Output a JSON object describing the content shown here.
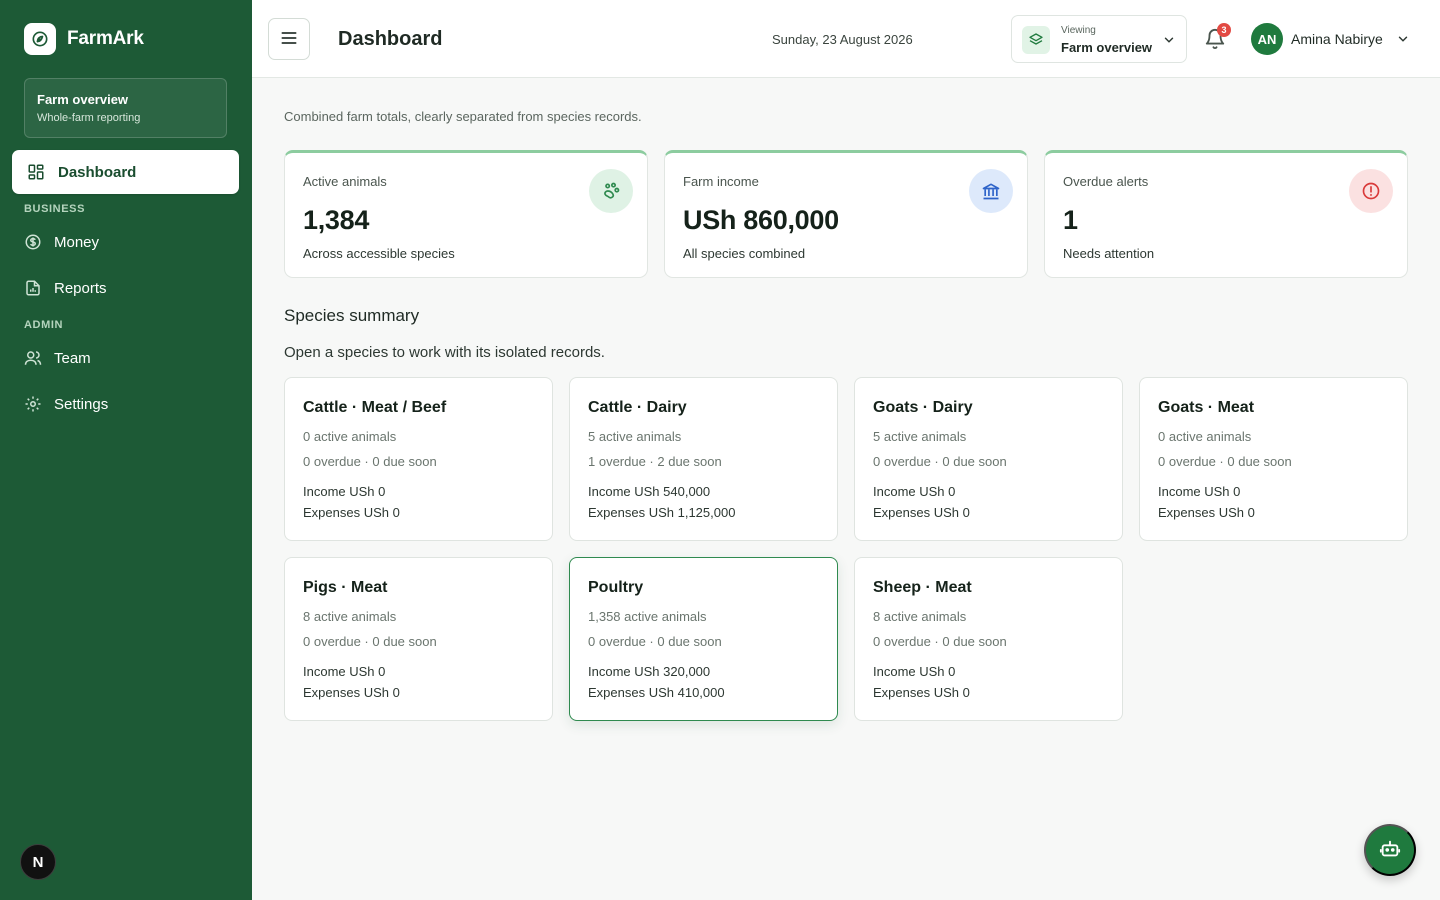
{
  "app": {
    "name": "FarmArk"
  },
  "sidebar": {
    "scope": {
      "title": "Farm overview",
      "subtitle": "Whole-farm reporting"
    },
    "active_item": {
      "label": "Dashboard",
      "icon": "dashboard-icon"
    },
    "sections": [
      {
        "label": "BUSINESS",
        "items": [
          {
            "label": "Money",
            "icon": "money-icon"
          },
          {
            "label": "Reports",
            "icon": "report-icon"
          }
        ]
      },
      {
        "label": "ADMIN",
        "items": [
          {
            "label": "Team",
            "icon": "user-icon"
          },
          {
            "label": "Settings",
            "icon": "gear-icon"
          }
        ]
      }
    ],
    "footer_badge": "N"
  },
  "header": {
    "title": "Dashboard",
    "date": "Sunday, 23 August 2026",
    "viewing_label": "Viewing",
    "viewing_value": "Farm overview",
    "notifications_count": "3",
    "user_initials": "AN",
    "user_name": "Amina Nabirye"
  },
  "main": {
    "intro": "Combined farm totals, clearly separated from species records.",
    "stats": [
      {
        "label": "Active animals",
        "value": "1,384",
        "sub": "Across accessible species",
        "icon": "paw-icon",
        "icon_bg": "#dff2e5",
        "icon_color": "#2f8a4f"
      },
      {
        "label": "Farm income",
        "value": "USh 860,000",
        "sub": "All species combined",
        "icon": "bank-icon",
        "icon_bg": "#dde9fb",
        "icon_color": "#2f64c9"
      },
      {
        "label": "Overdue alerts",
        "value": "1",
        "sub": "Needs attention",
        "icon": "alert-icon",
        "icon_bg": "#fbe1e1",
        "icon_color": "#d93a3a"
      }
    ],
    "species_title": "Species summary",
    "species_subtitle": "Open a species to work with its isolated records.",
    "species": [
      {
        "name": "Cattle · Meat / Beef",
        "animals": "0 active animals",
        "due": "0 overdue · 0 due soon",
        "income": "Income USh 0",
        "expenses": "Expenses USh 0"
      },
      {
        "name": "Cattle · Dairy",
        "animals": "5 active animals",
        "due": "1 overdue · 2 due soon",
        "income": "Income USh 540,000",
        "expenses": "Expenses USh 1,125,000"
      },
      {
        "name": "Goats · Dairy",
        "animals": "5 active animals",
        "due": "0 overdue · 0 due soon",
        "income": "Income USh 0",
        "expenses": "Expenses USh 0"
      },
      {
        "name": "Goats · Meat",
        "animals": "0 active animals",
        "due": "0 overdue · 0 due soon",
        "income": "Income USh 0",
        "expenses": "Expenses USh 0"
      },
      {
        "name": "Pigs · Meat",
        "animals": "8 active animals",
        "due": "0 overdue · 0 due soon",
        "income": "Income USh 0",
        "expenses": "Expenses USh 0"
      },
      {
        "name": "Poultry",
        "animals": "1,358 active animals",
        "due": "0 overdue · 0 due soon",
        "income": "Income USh 320,000",
        "expenses": "Expenses USh 410,000",
        "selected": true
      },
      {
        "name": "Sheep · Meat",
        "animals": "8 active animals",
        "due": "0 overdue · 0 due soon",
        "income": "Income USh 0",
        "expenses": "Expenses USh 0"
      }
    ]
  },
  "fab": {
    "icon": "robot-icon"
  },
  "colors": {
    "sidebar": "#1d5a36",
    "accent": "#1f7a3e",
    "alert": "#e24a43"
  }
}
